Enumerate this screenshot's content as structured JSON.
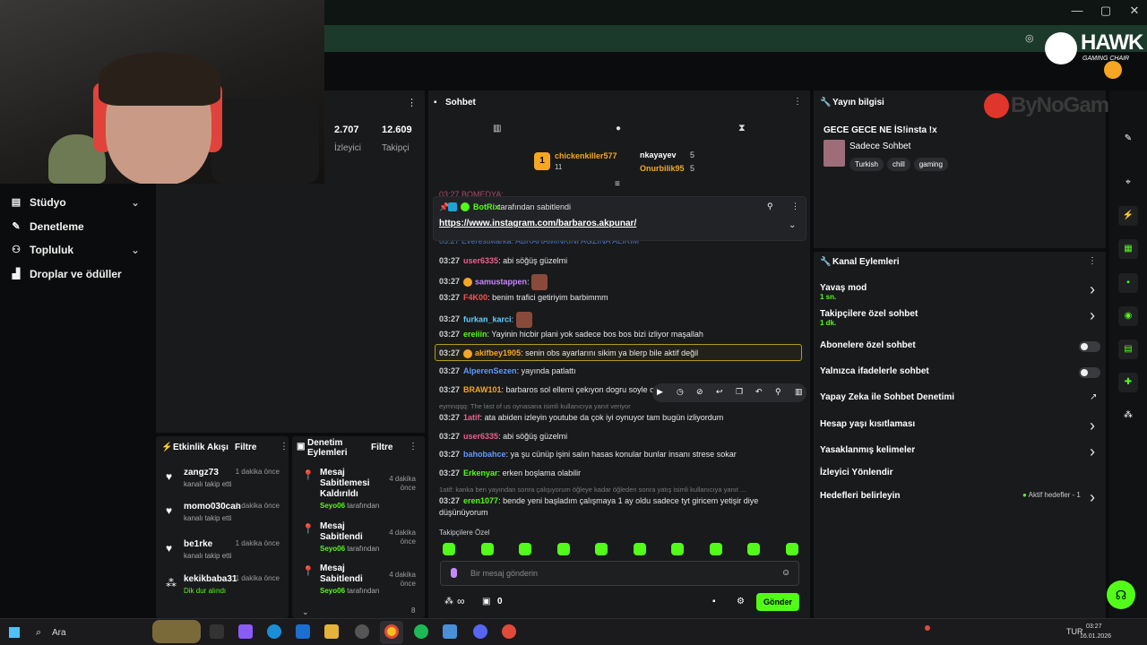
{
  "window": {
    "minimize": "—",
    "maximize": "▢",
    "close": "✕"
  },
  "brand": {
    "hawk": "HAWK",
    "hawk_sub": "GAMING CHAIR",
    "bynogame": "ByNoGame"
  },
  "nav": {
    "items": [
      {
        "label": "Stüdyo",
        "icon": "studio-icon",
        "has_chevron": true
      },
      {
        "label": "Denetleme",
        "icon": "moderation-icon",
        "has_chevron": false
      },
      {
        "label": "Topluluk",
        "icon": "community-icon",
        "has_chevron": true
      },
      {
        "label": "Droplar ve ödüller",
        "icon": "drops-icon",
        "has_chevron": false
      }
    ]
  },
  "stats": {
    "viewers_value": "2.707",
    "viewers_label": "İzleyici",
    "followers_value": "12.609",
    "followers_label": "Takipçi"
  },
  "activity": {
    "title": "Etkinlik Akışı",
    "filter": "Filtre",
    "items": [
      {
        "name": "zangz73",
        "sub": "kanalı takip etti",
        "time": "1 dakika önce",
        "icon": "heart-icon"
      },
      {
        "name": "momo030can",
        "sub": "kanalı takip etti",
        "time": "1 dakika önce",
        "icon": "heart-icon"
      },
      {
        "name": "be1rke",
        "sub": "kanalı takip etti",
        "time": "1 dakika önce",
        "icon": "heart-icon"
      },
      {
        "name": "kekikbaba31",
        "sub": "Dik dur alındı",
        "time": "1 dakika önce",
        "icon": "reward-icon"
      }
    ]
  },
  "modlog": {
    "title": "Denetim Eylemleri",
    "filter": "Filtre",
    "items": [
      {
        "action": "Mesaj Sabitlemesi Kaldırıldı",
        "by": "Seyo06",
        "by_suffix": "tarafından",
        "time": "4 dakika önce"
      },
      {
        "action": "Mesaj Sabitlendi",
        "by": "Seyo06",
        "by_suffix": "tarafından",
        "time": "4 dakika önce"
      },
      {
        "action": "Mesaj Sabitlendi",
        "by": "Seyo06",
        "by_suffix": "tarafından",
        "time": "4 dakika önce"
      }
    ],
    "count": "8"
  },
  "chat": {
    "title": "Sohbet",
    "leaderboard": [
      {
        "name": "chickenkiller577",
        "score": "11",
        "rank": "1"
      },
      {
        "name": "nkayayev",
        "score": "5"
      },
      {
        "name": "Onurbilik95",
        "score": "5"
      }
    ],
    "pinned": {
      "by": "BotRix",
      "by_suffix": "tarafından sabitlendi",
      "link": "https://www.instagram.com/barbaros.akpunar/"
    },
    "hidden_top_1": "03:27 BOMEDYA:",
    "hidden_top_2": "03:27 EverestMarka: ABRAHAMİNKİNİ AĞZINA ALIRIM",
    "messages": [
      {
        "time": "03:27",
        "user": "user6335",
        "color": "#e8618c",
        "text": "abi söğüş güzelmi"
      },
      {
        "time": "03:27",
        "user": "samustappen",
        "color": "#c58af9",
        "text": "",
        "emote": true,
        "badge": true
      },
      {
        "time": "03:27",
        "user": "F4K00",
        "color": "#ff4f4f",
        "text": "benim trafici getiriyim barbimmm"
      },
      {
        "time": "03:27",
        "user": "furkan_karci",
        "color": "#5fd0ff",
        "text": "",
        "emote": true
      },
      {
        "time": "03:27",
        "user": "ereiiin",
        "color": "#53fc18",
        "text": "Yayinin hicbir plani yok sadece bos bos bizi izliyor maşallah"
      },
      {
        "time": "03:27",
        "user": "akifbey1905",
        "color": "#f6a623",
        "text": "senin obs ayarlarını sikim ya blerp bile aktif değil",
        "highlight": true
      },
      {
        "time": "03:27",
        "user": "AlperenSezen",
        "color": "#5f9bff",
        "text": "yayında patlattı"
      },
      {
        "time": "03:27",
        "user": "BRAW101",
        "color": "#f6a623",
        "text": "barbaros sol ellemi çekıyon dogru soyle c"
      },
      {
        "time": "03:27",
        "user": "1atif",
        "color": "#e8618c",
        "text": "ata abiden izleyin youtube da çok iyi oynuyor tam bugün izliyordum",
        "reply": "eymnqqq: The last of us oynasana isimli kullanıcıya yanıt veriyor"
      },
      {
        "time": "03:27",
        "user": "user6335",
        "color": "#e8618c",
        "text": "abi söğüş güzelmi"
      },
      {
        "time": "03:27",
        "user": "bahobahce",
        "color": "#5f9bff",
        "text": "ya şu cünüp işini salın hasas konular bunlar insanı strese sokar"
      },
      {
        "time": "03:27",
        "user": "Erkenyar",
        "color": "#53fc18",
        "text": "erken boşlama olabilir"
      },
      {
        "time": "03:27",
        "user": "eren1077",
        "color": "#53fc18",
        "text": "bende yeni başladım çalışmaya 1 ay oldu sadece tyt giricem yetişir diye düşünüyorum",
        "reply": "1atif: kanka ben yayından sonra çalışıyorum öğleye kadar öğleden sonra yatış isimli kullanıcıya yanıt ..."
      }
    ],
    "followers_only": "Takipçilere Özel",
    "placeholder": "Bir mesaj gönderin",
    "send": "Gönder",
    "points": "0",
    "infinity": "∞"
  },
  "info": {
    "title": "Yayın bilgisi",
    "stream_title": "GECE GECE NE İS!insta !x",
    "category": "Sadece Sohbet",
    "tags": [
      "Turkish",
      "chill",
      "gaming"
    ]
  },
  "actions": {
    "title": "Kanal Eylemleri",
    "items": [
      {
        "label": "Yavaş mod",
        "sub": "1 sn.",
        "control": "arrow"
      },
      {
        "label": "Takipçilere özel sohbet",
        "sub": "1 dk.",
        "control": "arrow"
      },
      {
        "label": "Abonelere özel sohbet",
        "sub": "",
        "control": "toggle"
      },
      {
        "label": "Yalnızca ifadelerle sohbet",
        "sub": "",
        "control": "toggle"
      },
      {
        "label": "Yapay Zeka ile Sohbet Denetimi",
        "sub": "",
        "control": "external"
      },
      {
        "label": "Hesap yaşı kısıtlaması",
        "sub": "",
        "control": "arrow"
      },
      {
        "label": "Yasaklanmış kelimeler",
        "sub": "",
        "control": "arrow"
      },
      {
        "label": "İzleyici Yönlendir",
        "sub": "",
        "control": "none"
      },
      {
        "label": "Hedefleri belirleyin",
        "sub": "",
        "control": "arrow",
        "extra": "Aktif hedefler - 1"
      }
    ]
  },
  "taskbar": {
    "search": "Ara",
    "time": "03:27",
    "date": "16.01.2026",
    "lang": "TUR"
  },
  "colors": {
    "accent": "#53fc18",
    "panel": "#191a1c",
    "bg": "#0b0c0d"
  }
}
